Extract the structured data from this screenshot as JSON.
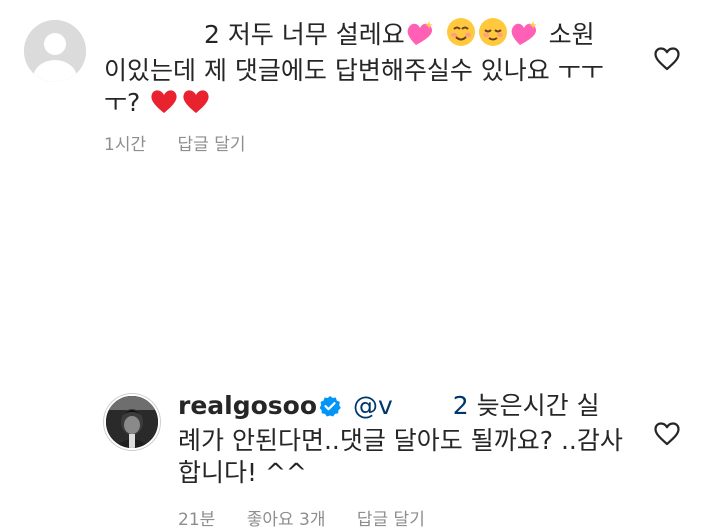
{
  "comments": [
    {
      "mention_suffix": "2",
      "text": "저두 너무 설레요",
      "text_after_emojis": "소원",
      "text_line2": "이있는데 제 댓글에도 답변해주실수 있나요 ㅜㅜ",
      "text_line3": "ㅜ?",
      "emojis": [
        "sparkling-heart",
        "smiling-face",
        "relieved-face",
        "sparkling-heart",
        "red-heart",
        "red-heart"
      ],
      "time": "1시간",
      "reply_label": "답글 달기",
      "like_icon": "heart-outline-icon"
    },
    {
      "username": "realgosoo",
      "verified": true,
      "mention_prefix": "@v",
      "mention_suffix": "2",
      "text_line1": "늦은시간 실",
      "text_line2": "례가 안된다면..댓글 달아도 될까요? ..감사",
      "text_line3": "합니다! ^^",
      "time": "21분",
      "likes": "좋아요 3개",
      "reply_label": "답글 달기",
      "like_icon": "heart-outline-icon"
    }
  ],
  "colors": {
    "text": "#262626",
    "meta": "#8e8e8e",
    "mention": "#00376b",
    "verified": "#0095f6",
    "emoji_pink": "#ff5fb4",
    "emoji_red": "#e8232f",
    "emoji_yellow": "#ffc83d"
  }
}
